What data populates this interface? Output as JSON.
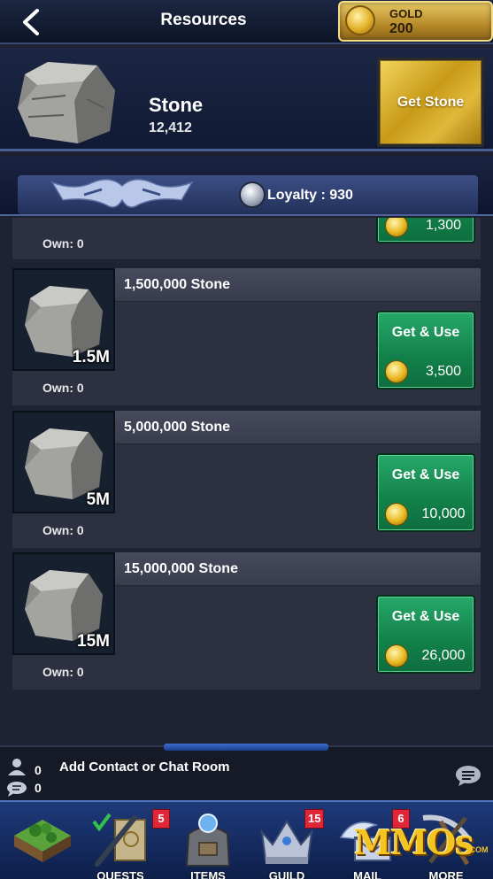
{
  "header": {
    "title": "Resources",
    "gold_label": "GOLD",
    "gold_value": "200"
  },
  "resource": {
    "name": "Stone",
    "count": "12,412",
    "get_button": "Get Stone"
  },
  "loyalty": {
    "text": "Loyalty : 930"
  },
  "items": [
    {
      "title": "",
      "qty_label": "",
      "own": "Own: 0",
      "price": "1,300"
    },
    {
      "title": "1,500,000 Stone",
      "qty_label": "1.5M",
      "own": "Own: 0",
      "button_label": "Get & Use",
      "price": "3,500"
    },
    {
      "title": "5,000,000 Stone",
      "qty_label": "5M",
      "own": "Own: 0",
      "button_label": "Get & Use",
      "price": "10,000"
    },
    {
      "title": "15,000,000 Stone",
      "qty_label": "15M",
      "own": "Own: 0",
      "button_label": "Get & Use",
      "price": "26,000"
    }
  ],
  "chat": {
    "contacts_count": "0",
    "messages_count": "0",
    "add_text": "Add Contact or Chat Room"
  },
  "nav": {
    "items": [
      {
        "label": "",
        "icon": "kingdom-map-icon",
        "badge": ""
      },
      {
        "label": "QUESTS",
        "icon": "quest-scroll-icon",
        "badge": "5"
      },
      {
        "label": "ITEMS",
        "icon": "items-bag-icon",
        "badge": ""
      },
      {
        "label": "GUILD",
        "icon": "guild-crown-icon",
        "badge": "15"
      },
      {
        "label": "MAIL",
        "icon": "mail-wing-icon",
        "badge": "6"
      },
      {
        "label": "MORE",
        "icon": "more-tools-icon",
        "badge": ""
      }
    ]
  },
  "watermark": {
    "text": "MMOs",
    "suffix": ".COM"
  },
  "colors": {
    "gold_button": "#d9ad2c",
    "get_use_button": "#1a8a52",
    "badge": "#e0273a",
    "nav_bg": "#1f3a7a"
  }
}
